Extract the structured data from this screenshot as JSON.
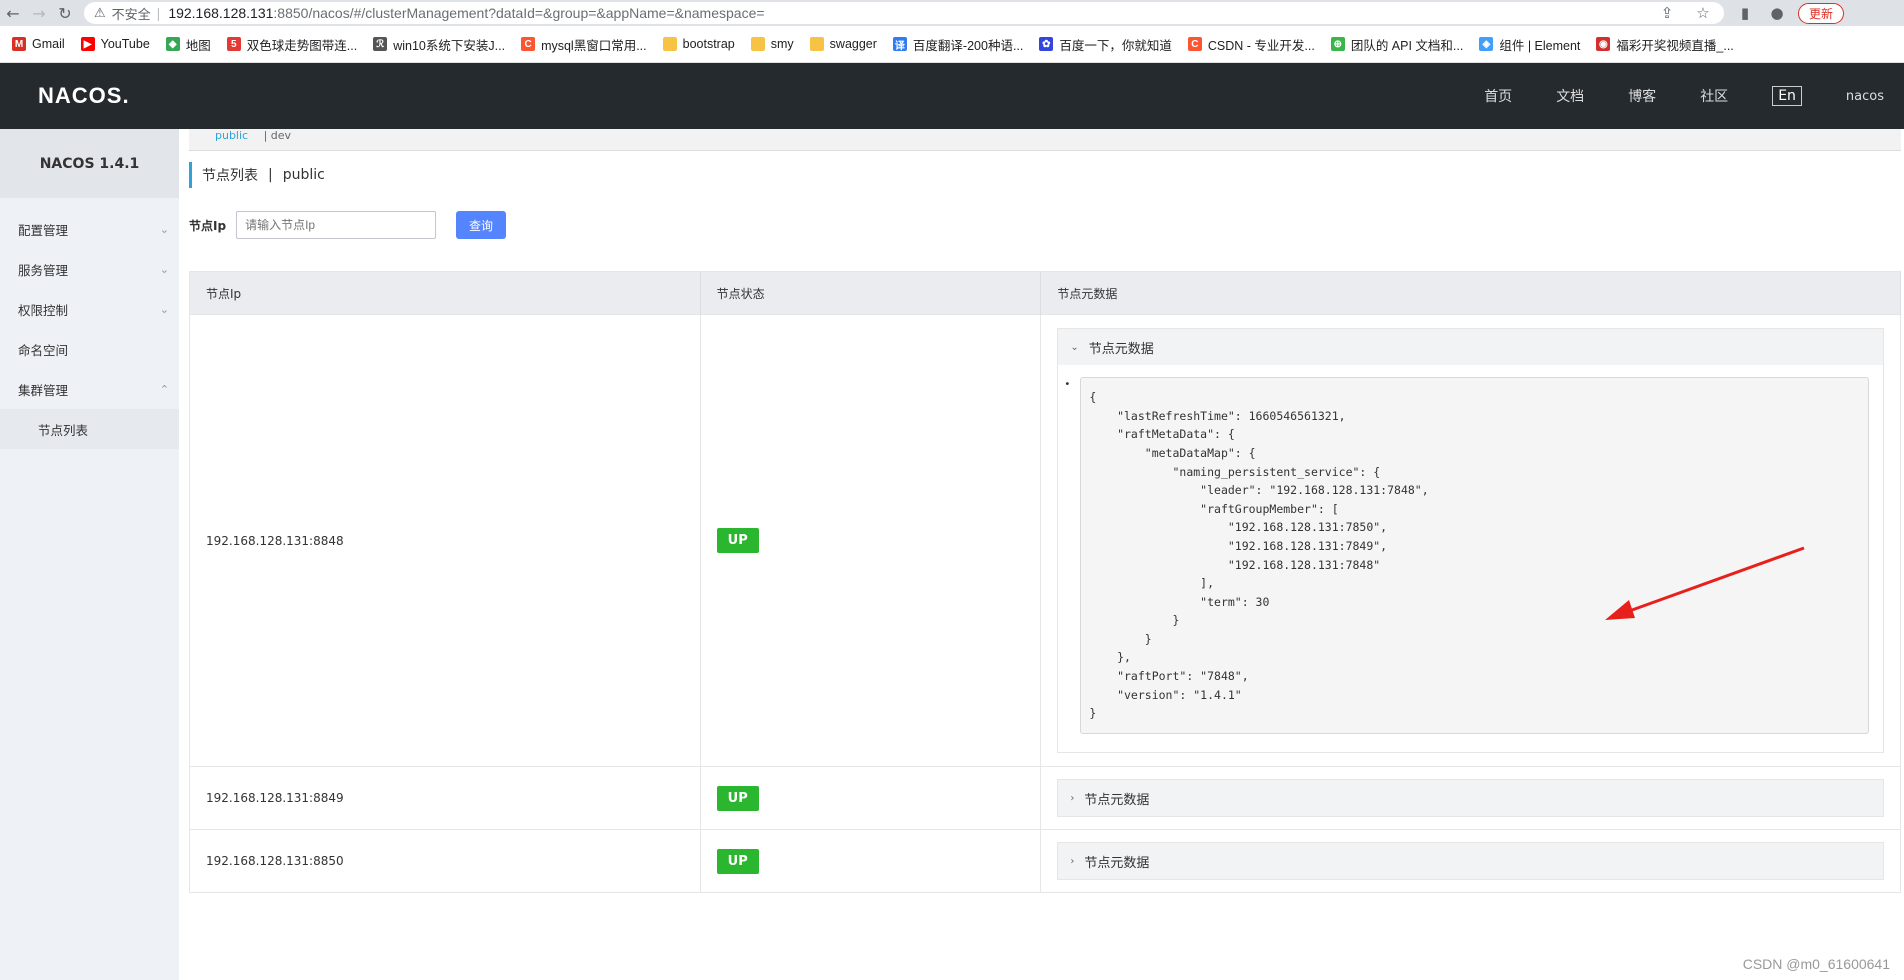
{
  "browser": {
    "insecure_label": "不安全",
    "url_host": "192.168.128.131",
    "url_rest": ":8850/nacos/#/clusterManagement?dataId=&group=&appName=&namespace=",
    "update_label": "更新"
  },
  "bookmarks": [
    {
      "label": "Gmail",
      "icon": "gmail-icon",
      "color": "#d93025",
      "glyph": "M"
    },
    {
      "label": "YouTube",
      "icon": "youtube-icon",
      "color": "#ff0000",
      "glyph": "▶"
    },
    {
      "label": "地图",
      "icon": "maps-icon",
      "color": "#34a853",
      "glyph": "◆"
    },
    {
      "label": "双色球走势图带连...",
      "icon": "lottery-icon",
      "color": "#e53935",
      "glyph": "5"
    },
    {
      "label": "win10系统下安装J...",
      "icon": "win-icon",
      "color": "#555555",
      "glyph": "ℛ"
    },
    {
      "label": "mysql黑窗口常用...",
      "icon": "csdn-icon",
      "color": "#fc5531",
      "glyph": "C"
    },
    {
      "label": "bootstrap",
      "icon": "folder-icon",
      "color": "#f6c344",
      "glyph": ""
    },
    {
      "label": "smy",
      "icon": "folder-icon",
      "color": "#f6c344",
      "glyph": ""
    },
    {
      "label": "swagger",
      "icon": "folder-icon",
      "color": "#f6c344",
      "glyph": ""
    },
    {
      "label": "百度翻译-200种语...",
      "icon": "translate-icon",
      "color": "#2e7cf6",
      "glyph": "译"
    },
    {
      "label": "百度一下，你就知道",
      "icon": "baidu-icon",
      "color": "#3245df",
      "glyph": "✿"
    },
    {
      "label": "CSDN - 专业开发...",
      "icon": "csdn-icon",
      "color": "#fc5531",
      "glyph": "C"
    },
    {
      "label": "团队的 API 文档和...",
      "icon": "api-icon",
      "color": "#3ab54a",
      "glyph": "⊕"
    },
    {
      "label": "组件 | Element",
      "icon": "element-icon",
      "color": "#409eff",
      "glyph": "◈"
    },
    {
      "label": "福彩开奖视频直播_...",
      "icon": "lottery-icon",
      "color": "#d32f2f",
      "glyph": "◉"
    }
  ],
  "header": {
    "logo": "NACOS.",
    "menu": [
      "首页",
      "文档",
      "博客",
      "社区"
    ],
    "lang": "En",
    "user": "nacos"
  },
  "sidebar": {
    "version": "NACOS 1.4.1",
    "items": [
      {
        "label": "配置管理",
        "chevron": "⌄"
      },
      {
        "label": "服务管理",
        "chevron": "⌄"
      },
      {
        "label": "权限控制",
        "chevron": "⌄"
      },
      {
        "label": "命名空间",
        "chevron": ""
      },
      {
        "label": "集群管理",
        "chevron": "⌃"
      }
    ],
    "sub_item": "节点列表"
  },
  "breadcrumb": {
    "public": "public",
    "dev": "| dev"
  },
  "page": {
    "title": "节点列表",
    "sep": "|",
    "namespace": "public",
    "search_label": "节点Ip",
    "search_placeholder": "请输入节点Ip",
    "search_button": "查询"
  },
  "table": {
    "headers": [
      "节点Ip",
      "节点状态",
      "节点元数据"
    ],
    "rows": [
      {
        "ip": "192.168.128.131:8848",
        "status": "UP",
        "meta_label": "节点元数据",
        "expanded": true
      },
      {
        "ip": "192.168.128.131:8849",
        "status": "UP",
        "meta_label": "节点元数据",
        "expanded": false
      },
      {
        "ip": "192.168.128.131:8850",
        "status": "UP",
        "meta_label": "节点元数据",
        "expanded": false
      }
    ],
    "json_text": "{\n    \"lastRefreshTime\": 1660546561321,\n    \"raftMetaData\": {\n        \"metaDataMap\": {\n            \"naming_persistent_service\": {\n                \"leader\": \"192.168.128.131:7848\",\n                \"raftGroupMember\": [\n                    \"192.168.128.131:7850\",\n                    \"192.168.128.131:7849\",\n                    \"192.168.128.131:7848\"\n                ],\n                \"term\": 30\n            }\n        }\n    },\n    \"raftPort\": \"7848\",\n    \"version\": \"1.4.1\"\n}"
  },
  "watermark": "CSDN @m0_61600641",
  "colors": {
    "accent": "#2fa3d8",
    "up": "#2ab62e",
    "button": "#5584ff",
    "arrow": "#e8201c"
  }
}
